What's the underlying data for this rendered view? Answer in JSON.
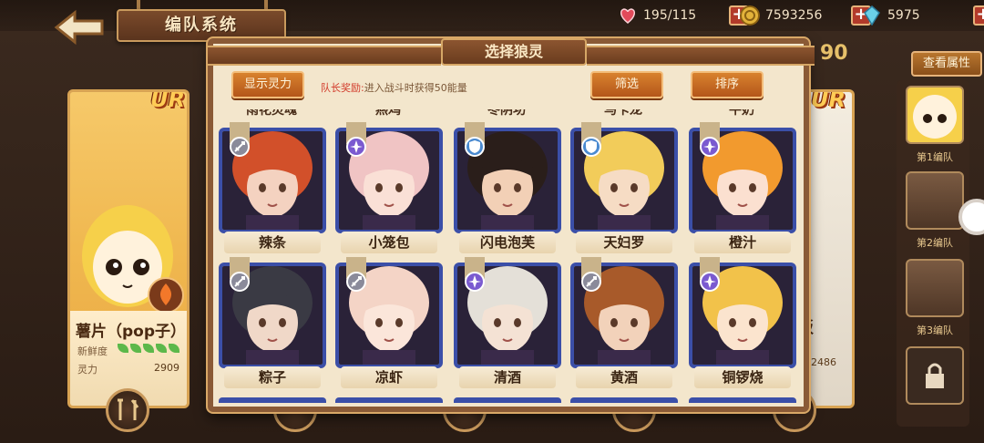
{
  "header": {
    "title": "编队系统",
    "resources": [
      {
        "name": "heart-icon",
        "value": "195/115",
        "color": "#e24a5a"
      },
      {
        "name": "coin-icon",
        "value": "7593256",
        "color": "#e2b23a"
      },
      {
        "name": "crystal-icon",
        "value": "5975",
        "color": "#6ad0e8"
      }
    ]
  },
  "background": {
    "number": "90",
    "left_card": {
      "rarity": "UR",
      "name": "薯片（pop子）",
      "freshness_label": "新鲜度",
      "power_label": "灵力",
      "power_value": "2909"
    },
    "right_card": {
      "rarity": "UR",
      "name_fragment": "饭",
      "power_value": "2486"
    },
    "view_attr_label": "查看属性",
    "teams": [
      {
        "label": "第1编队"
      },
      {
        "label": "第2编队"
      },
      {
        "label": "第3编队"
      }
    ]
  },
  "dialog": {
    "title": "选择狼灵",
    "show_power_label": "显示灵力",
    "reward_key": "队长奖励:",
    "reward_value": "进入战斗时获得50能量",
    "filter_label": "筛选",
    "sort_label": "排序",
    "top_partial_names": [
      "雨花灵魂",
      "燕鸡",
      "冬阴功",
      "马卡龙",
      "牛奶"
    ],
    "rows": [
      [
        {
          "name": "辣条",
          "badge": "sword",
          "badge_color": "#8a8a9a",
          "hair": "#d2502a",
          "skin": "#f4d2c0"
        },
        {
          "name": "小笼包",
          "badge": "magic",
          "badge_color": "#7a5ad0",
          "hair": "#f0c4c4",
          "skin": "#fae0d6"
        },
        {
          "name": "闪电泡芙",
          "badge": "shield",
          "badge_color": "#4a8ad0",
          "hair": "#2a1e1a",
          "skin": "#f2d0b6"
        },
        {
          "name": "天妇罗",
          "badge": "shield",
          "badge_color": "#4a8ad0",
          "hair": "#f2cc5a",
          "skin": "#f6dcc4"
        },
        {
          "name": "橙汁",
          "badge": "magic",
          "badge_color": "#7a5ad0",
          "hair": "#f29a2e",
          "skin": "#fbe0d0"
        }
      ],
      [
        {
          "name": "粽子",
          "badge": "sword",
          "badge_color": "#8a8a9a",
          "hair": "#3a3a44",
          "skin": "#f0d8c8"
        },
        {
          "name": "凉虾",
          "badge": "sword",
          "badge_color": "#8a8a9a",
          "hair": "#f4d4c6",
          "skin": "#fbe6da"
        },
        {
          "name": "清酒",
          "badge": "magic",
          "badge_color": "#7a5ad0",
          "hair": "#e4e0d8",
          "skin": "#f4e2d4"
        },
        {
          "name": "黄酒",
          "badge": "sword",
          "badge_color": "#8a8a9a",
          "hair": "#a85a2a",
          "skin": "#f2d2ba"
        },
        {
          "name": "铜锣烧",
          "badge": "magic",
          "badge_color": "#7a5ad0",
          "hair": "#f2c24a",
          "skin": "#fbe4ce"
        }
      ]
    ]
  }
}
